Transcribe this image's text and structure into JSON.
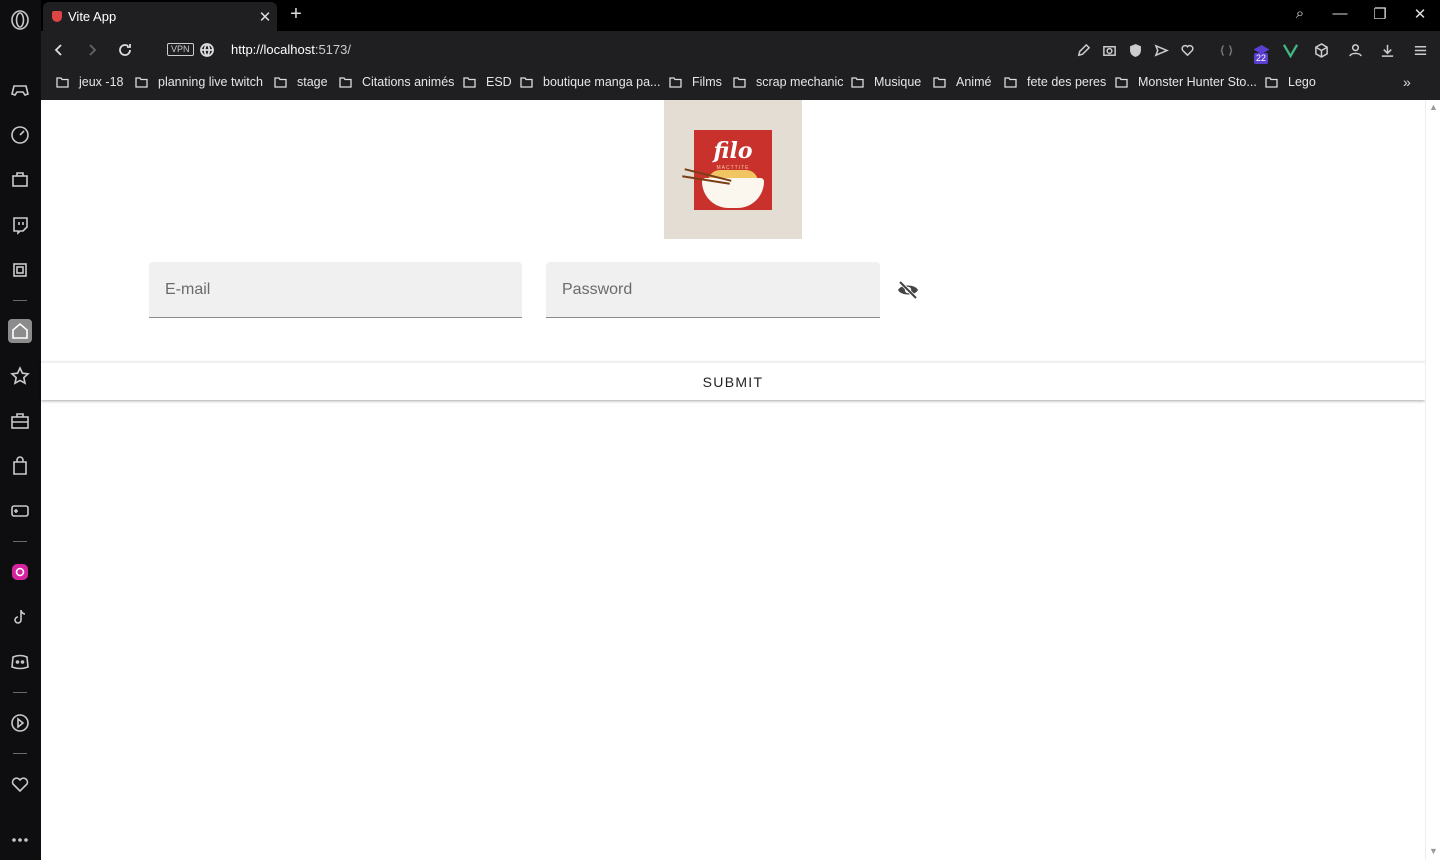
{
  "browser": {
    "tab_title": "Vite App",
    "tab_close": "✕",
    "new_tab": "+",
    "url_host": "http://localhost",
    "url_rest": ":5173/",
    "vpn_label": "VPN",
    "extension_badge": "22",
    "window_controls": [
      "⌕",
      "—",
      "❐",
      "✕"
    ]
  },
  "bookmarks": {
    "items": [
      "jeux -18",
      "planning live twitch",
      "stage",
      "Citations animés",
      "ESD",
      "boutique manga pa...",
      "Films",
      "scrap mechanic",
      "Musique",
      "Animé",
      "fete des peres",
      "Monster Hunter Sto...",
      "Lego"
    ],
    "more": "»"
  },
  "page": {
    "logo": {
      "text": "ﬁlo",
      "subtitle": "MACTTITE"
    },
    "email_placeholder": "E-mail",
    "password_placeholder": "Password",
    "submit_label": "SUBMIT",
    "visibility_icon": "eye-off-icon"
  },
  "colors": {
    "accent_sidebar_active": "#8c8c8c",
    "logo_red": "#c8312c",
    "page_bg": "#ffffff"
  }
}
